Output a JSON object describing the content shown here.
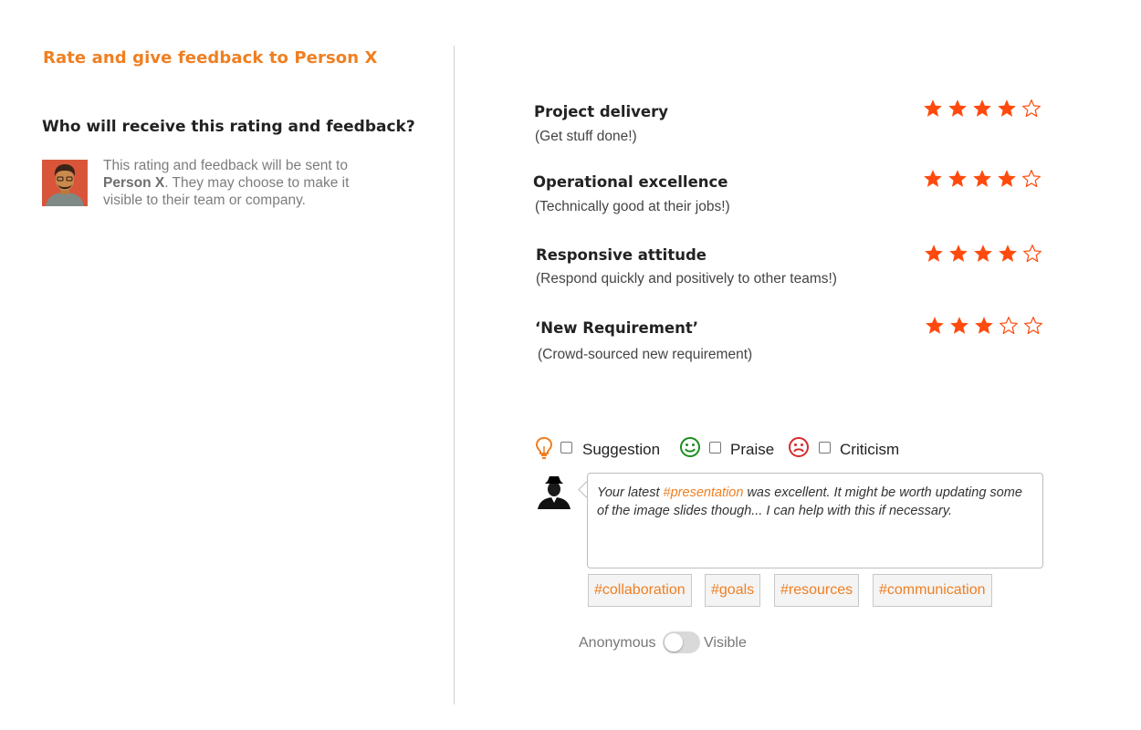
{
  "header": {
    "title": "Rate and give feedback to Person X"
  },
  "recipient": {
    "heading": "Who will receive this rating and feedback?",
    "note_prefix": "This rating and feedback will be sent to ",
    "name": "Person X",
    "note_suffix": ". They may choose to make it visible to their team or company."
  },
  "criteria": [
    {
      "name": "Project delivery",
      "description": "(Get stuff done!)",
      "rating": 4,
      "max": 5
    },
    {
      "name": "Operational excellence",
      "description": "(Technically good at their jobs!)",
      "rating": 4,
      "max": 5
    },
    {
      "name": "Responsive attitude",
      "description": "(Respond quickly and positively to other teams!)",
      "rating": 4,
      "max": 5
    },
    {
      "name": "‘New Requirement’",
      "description": "(Crowd-sourced new requirement)",
      "rating": 3,
      "max": 5
    }
  ],
  "feedback_types": [
    {
      "label": "Suggestion",
      "icon": "lightbulb-icon",
      "checked": false,
      "color": "#f07f22"
    },
    {
      "label": "Praise",
      "icon": "smiley-icon",
      "checked": false,
      "color": "#1e8c1e"
    },
    {
      "label": "Criticism",
      "icon": "frown-icon",
      "checked": false,
      "color": "#d62b2b"
    }
  ],
  "feedback": {
    "text_before": "Your latest ",
    "hashtag": "#presentation",
    "text_after": " was excellent. It might be worth updating some of the image slides though... I can help with this if necessary."
  },
  "tags": [
    "#collaboration",
    "#goals",
    "#resources",
    "#communication"
  ],
  "visibility": {
    "left_label": "Anonymous",
    "right_label": "Visible",
    "value": "Anonymous"
  },
  "colors": {
    "accent": "#f07f22",
    "star": "#ff4a0d",
    "divider": "#cfcfcf"
  }
}
